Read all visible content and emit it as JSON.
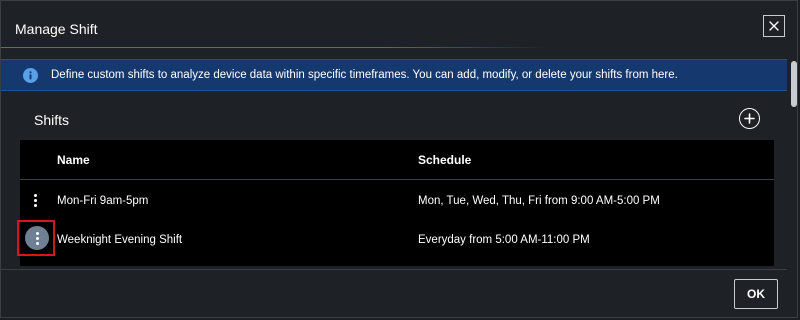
{
  "dialog": {
    "title": "Manage Shift",
    "close_icon": "close-icon"
  },
  "banner": {
    "icon": "info-icon",
    "text": "Define custom shifts to analyze device data within specific timeframes. You can add, modify, or delete your shifts from here.",
    "color": "#15396f"
  },
  "section": {
    "title": "Shifts",
    "add_icon": "plus-circle-icon"
  },
  "table": {
    "columns": [
      "Name",
      "Schedule"
    ],
    "rows": [
      {
        "name": "Mon-Fri 9am-5pm",
        "schedule": "Mon, Tue, Wed, Thu, Fri from 9:00 AM-5:00 PM"
      },
      {
        "name": "Weeknight Evening Shift",
        "schedule": "Everyday from 5:00 AM-11:00 PM"
      }
    ]
  },
  "footer": {
    "ok_label": "OK"
  },
  "colors": {
    "background": "#1e2227",
    "table_background": "#000000",
    "accent": "#3d6fb6",
    "highlight": "#d01a1a"
  }
}
